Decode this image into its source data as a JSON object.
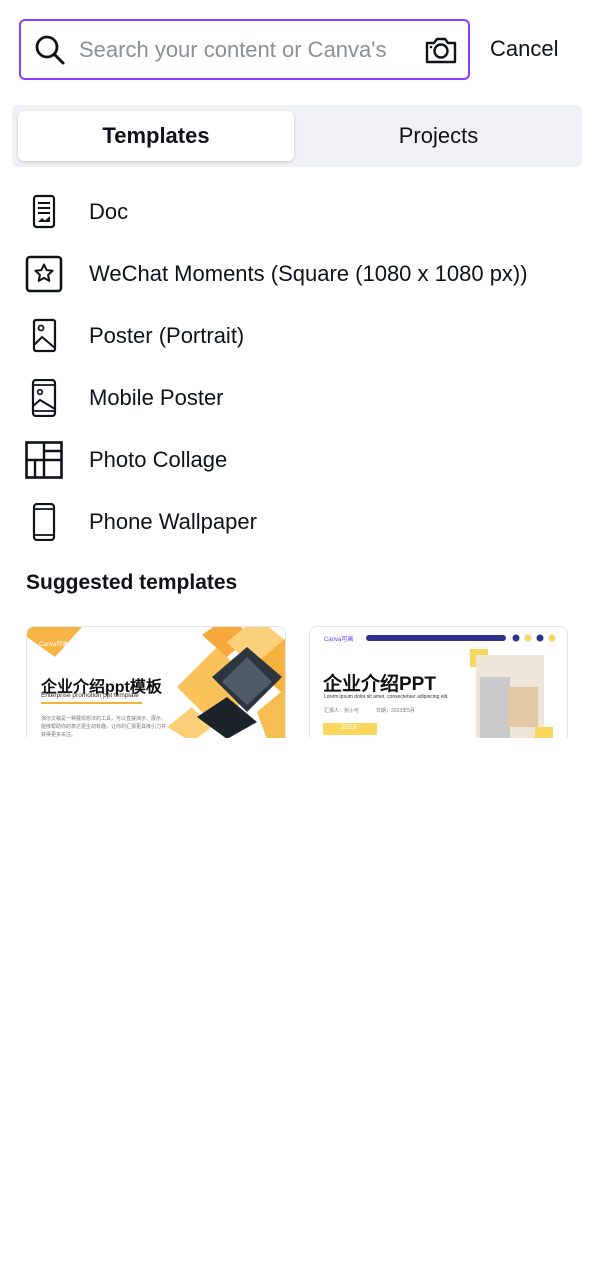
{
  "search": {
    "placeholder": "Search your content or Canva's"
  },
  "cancel_label": "Cancel",
  "tabs": [
    {
      "label": "Templates",
      "active": true
    },
    {
      "label": "Projects",
      "active": false
    }
  ],
  "items": [
    {
      "label": "Doc",
      "icon": "doc-icon"
    },
    {
      "label": "WeChat Moments (Square (1080 x 1080 px))",
      "icon": "star-square-icon"
    },
    {
      "label": "Poster (Portrait)",
      "icon": "poster-icon"
    },
    {
      "label": "Mobile Poster",
      "icon": "mobile-poster-icon"
    },
    {
      "label": "Photo Collage",
      "icon": "collage-icon"
    },
    {
      "label": "Phone Wallpaper",
      "icon": "phone-icon"
    }
  ],
  "suggested_title": "Suggested templates",
  "templates": [
    {
      "brand": "Canva可画",
      "title": "企业介绍ppt模板",
      "subtitle": "Enterprise promotion ppt template",
      "body": "演示文稿是一种展现想法的工具，可以直接演示、展示，能够帮助你的表达更生动有趣。让你的汇报更具吸引力并获得更多关注。",
      "accent": "#f5b93a"
    },
    {
      "brand": "Canva可画",
      "title": "企业介绍PPT",
      "subtitle": "Lorem ipsum dolor sit amet, consectetuer adipiscing elit.",
      "meta_reporter": "汇报人：张小可",
      "meta_date": "日期：2023年5月",
      "year": "2023",
      "accent": "#2d3190",
      "highlight": "#f9d65c"
    }
  ]
}
